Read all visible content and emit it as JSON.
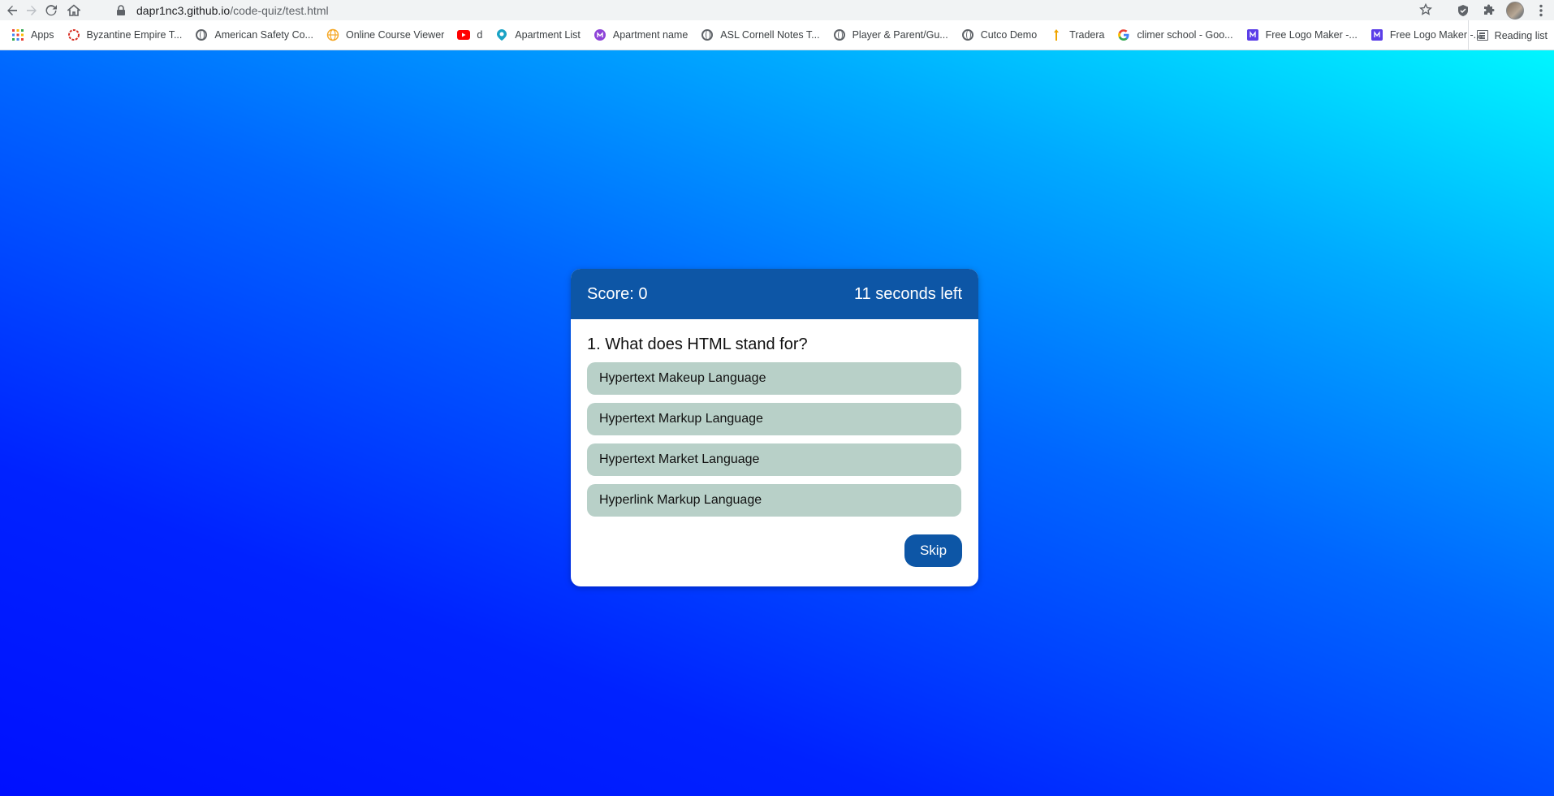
{
  "browser": {
    "url_host": "dapr1nc3.github.io",
    "url_path": "/code-quiz/test.html",
    "icons": [
      "back-icon",
      "forward-icon",
      "reload-icon",
      "home-icon",
      "lock-icon",
      "star-icon",
      "shield-icon",
      "puzzle-icon",
      "menu-icon"
    ]
  },
  "bookmarks": {
    "items": [
      {
        "label": "Apps",
        "icon": "apps-grid-icon"
      },
      {
        "label": "Byzantine Empire T...",
        "icon": "ring-icon"
      },
      {
        "label": "American Safety Co...",
        "icon": "globe-icon"
      },
      {
        "label": "Online Course Viewer",
        "icon": "globe-orange-icon"
      },
      {
        "label": "d",
        "icon": "youtube-icon"
      },
      {
        "label": "Apartment List",
        "icon": "apartment-list-icon"
      },
      {
        "label": "Apartment name",
        "icon": "purple-logo-icon"
      },
      {
        "label": "ASL Cornell Notes T...",
        "icon": "globe-icon"
      },
      {
        "label": "Player & Parent/Gu...",
        "icon": "globe-icon"
      },
      {
        "label": "Cutco Demo",
        "icon": "globe-icon"
      },
      {
        "label": "Tradera",
        "icon": "tradera-icon"
      },
      {
        "label": "climer school - Goo...",
        "icon": "google-icon"
      },
      {
        "label": "Free Logo Maker -...",
        "icon": "logo-maker-icon"
      },
      {
        "label": "Free Logo Maker -...",
        "icon": "logo-maker-icon"
      }
    ],
    "more": "»",
    "reading_list": "Reading list"
  },
  "quiz": {
    "score_text": "Score: 0",
    "timer_text": "11 seconds left",
    "question": "1. What does HTML stand for?",
    "answers": [
      "Hypertext Makeup Language",
      "Hypertext Markup Language",
      "Hypertext Market Language",
      "Hyperlink Markup Language"
    ],
    "skip_label": "Skip"
  },
  "colors": {
    "header_bg": "#0d56a6",
    "answer_bg": "#b8d0c8",
    "page_gradient_top": "#00f6ff",
    "page_gradient_bottom": "#0010ff"
  }
}
